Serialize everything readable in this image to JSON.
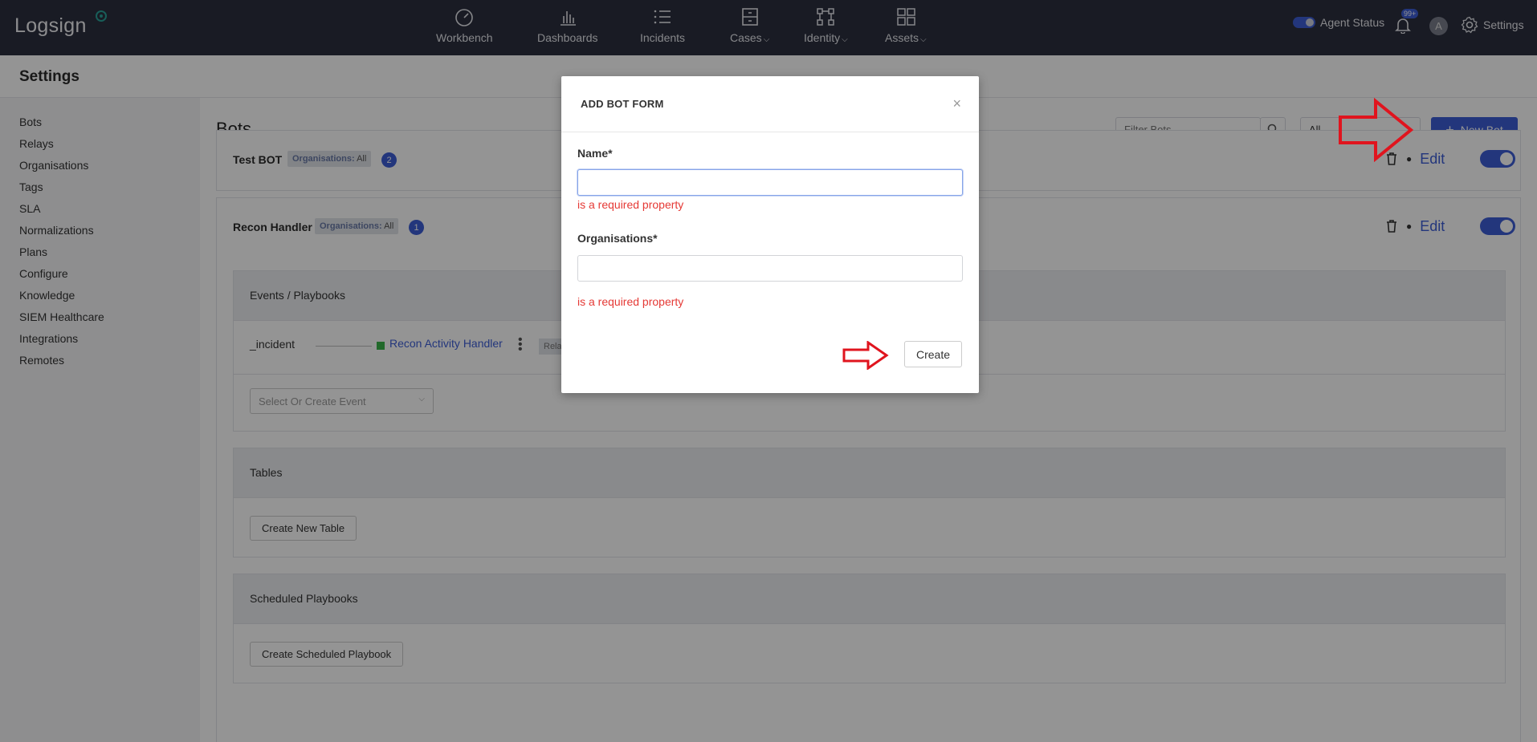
{
  "topbar": {
    "logo": "Logsign",
    "nav": [
      {
        "label": "Workbench",
        "icon": "speedometer-icon",
        "dropdown": false
      },
      {
        "label": "Dashboards",
        "icon": "bar-chart-icon",
        "dropdown": false
      },
      {
        "label": "Incidents",
        "icon": "list-icon",
        "dropdown": false
      },
      {
        "label": "Cases",
        "icon": "cabinet-icon",
        "dropdown": true
      },
      {
        "label": "Identity",
        "icon": "nodes-icon",
        "dropdown": true
      },
      {
        "label": "Assets",
        "icon": "grid-icon",
        "dropdown": true
      }
    ],
    "agent_status": "Agent Status",
    "notification_count": "99+",
    "avatar_letter": "A",
    "settings_label": "Settings"
  },
  "page": {
    "title": "Settings"
  },
  "sidebar": {
    "items": [
      {
        "label": "Bots"
      },
      {
        "label": "Relays"
      },
      {
        "label": "Organisations"
      },
      {
        "label": "Tags"
      },
      {
        "label": "SLA"
      },
      {
        "label": "Normalizations"
      },
      {
        "label": "Plans"
      },
      {
        "label": "Configure"
      },
      {
        "label": "Knowledge"
      },
      {
        "label": "SIEM Healthcare"
      },
      {
        "label": "Integrations"
      },
      {
        "label": "Remotes"
      }
    ]
  },
  "main": {
    "title": "Bots",
    "filter_placeholder": "Filter Bots",
    "all_select": "All",
    "new_bot_label": "New Bot",
    "bots": [
      {
        "name": "Test BOT",
        "org_label": "Organisations:",
        "org_value": "All",
        "count": "2",
        "edit": "Edit"
      },
      {
        "name": "Recon Handler",
        "org_label": "Organisations:",
        "org_value": "All",
        "count": "1",
        "edit": "Edit"
      }
    ],
    "events_section": {
      "title": "Events / Playbooks",
      "event_name": "_incident",
      "playbook": "Recon Activity Handler",
      "truncated_badge": "Rela",
      "select_placeholder": "Select Or Create Event"
    },
    "tables_section": {
      "title": "Tables",
      "button": "Create New Table"
    },
    "scheduled_section": {
      "title": "Scheduled Playbooks",
      "button": "Create Scheduled Playbook"
    }
  },
  "modal": {
    "title": "ADD BOT FORM",
    "name_label": "Name*",
    "name_value": "",
    "name_error": "is a required property",
    "org_label": "Organisations*",
    "org_value": "",
    "org_error": "is a required property",
    "create_label": "Create"
  },
  "colors": {
    "accent": "#3d5ed6",
    "error": "#e53935",
    "annotation": "#e0141e",
    "topbar": "#2b2f3e"
  }
}
